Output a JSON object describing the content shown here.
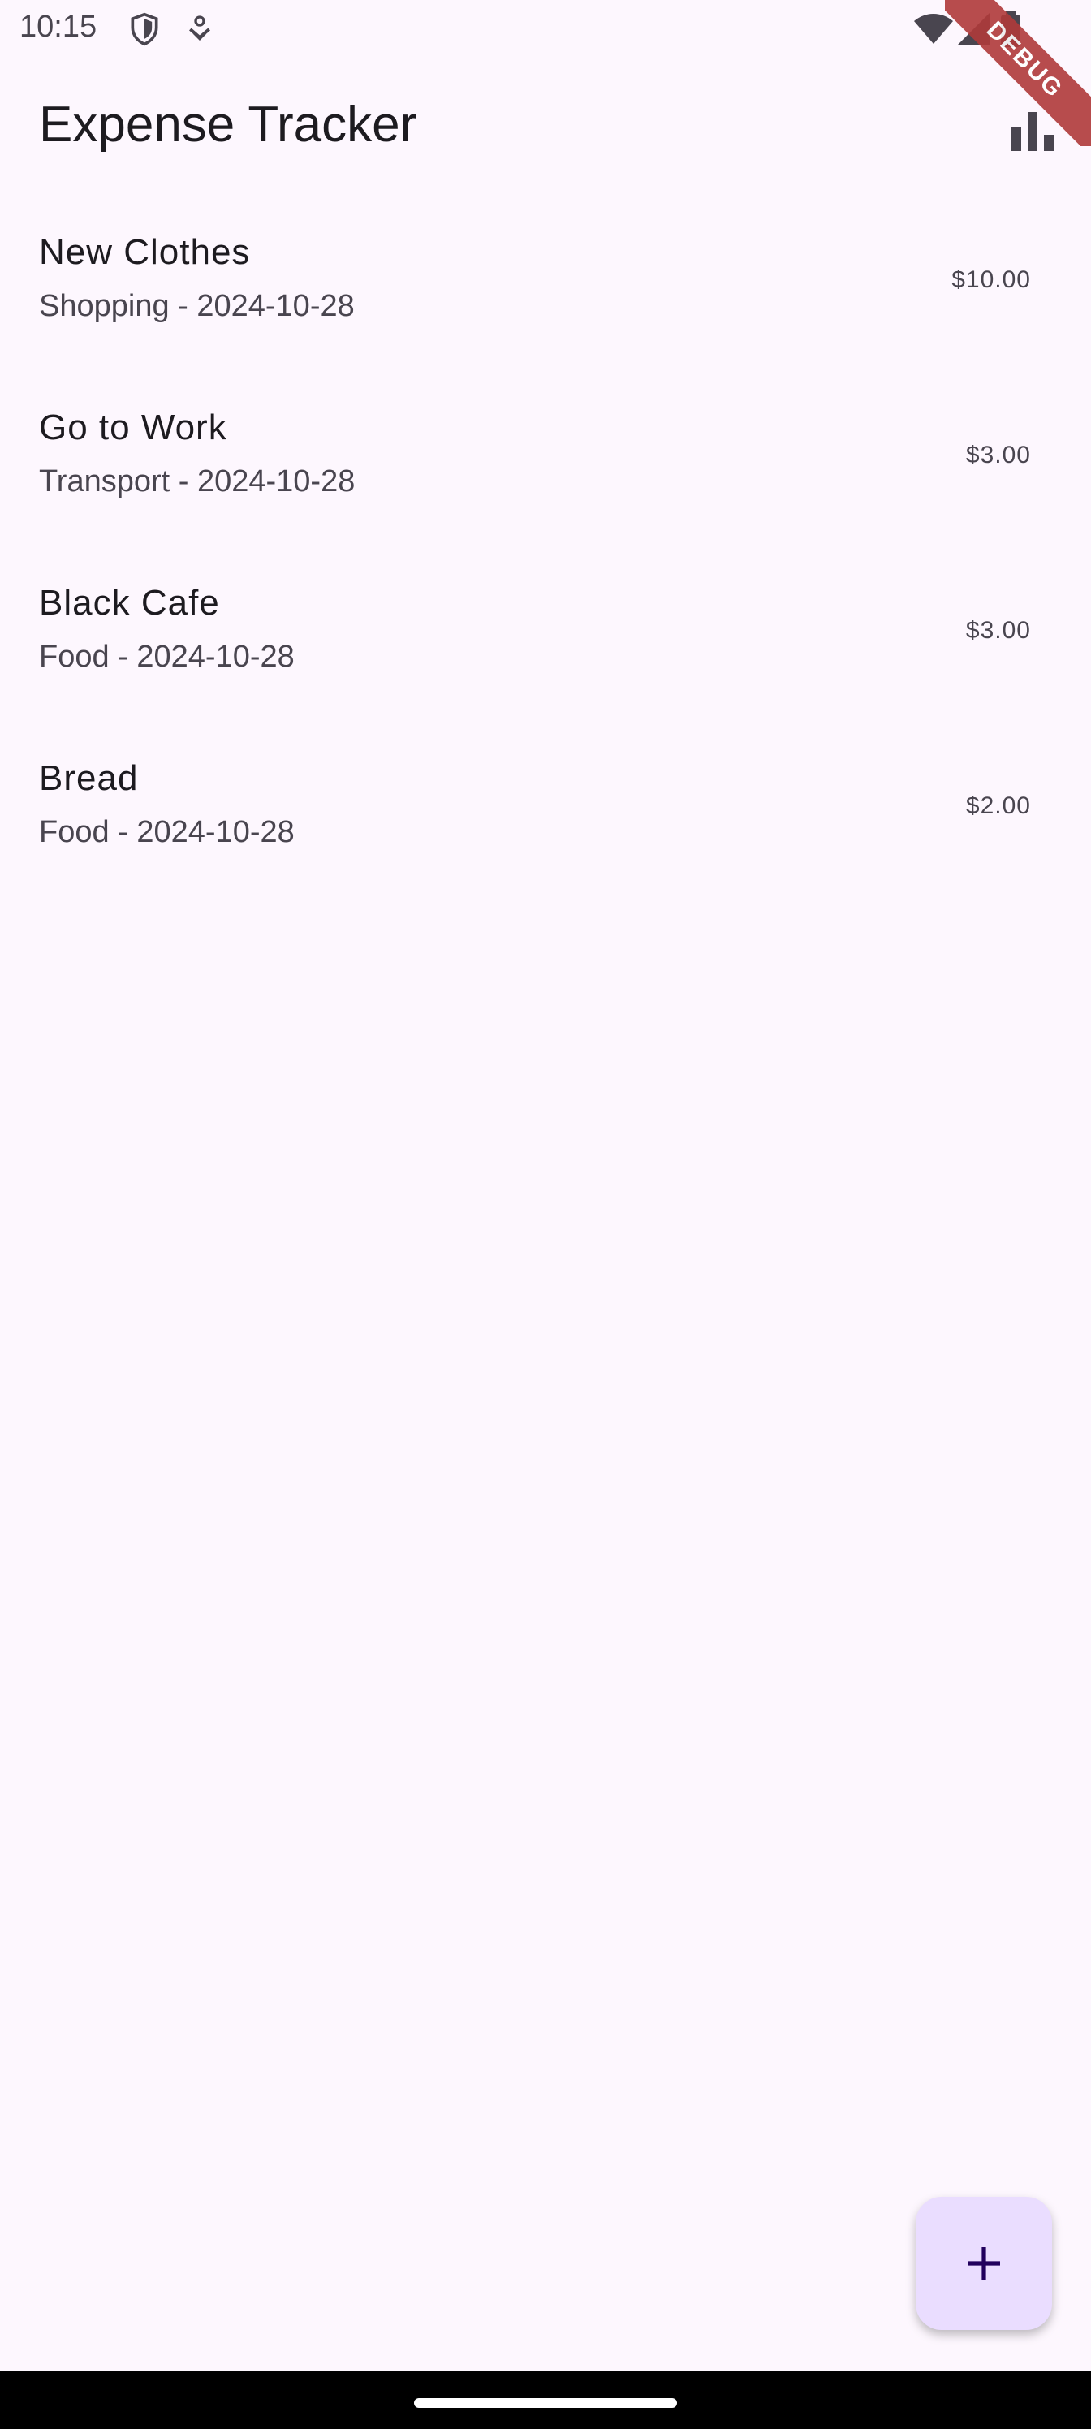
{
  "status_bar": {
    "time": "10:15",
    "debug_label": "DEBUG"
  },
  "app_bar": {
    "title": "Expense Tracker",
    "stats_icon": "bar-chart-icon"
  },
  "expenses": [
    {
      "title": "New Clothes",
      "subtitle": "Shopping - 2024-10-28",
      "amount": "$10.00"
    },
    {
      "title": "Go to Work",
      "subtitle": "Transport - 2024-10-28",
      "amount": "$3.00"
    },
    {
      "title": "Black Cafe",
      "subtitle": "Food - 2024-10-28",
      "amount": "$3.00"
    },
    {
      "title": "Bread",
      "subtitle": "Food - 2024-10-28",
      "amount": "$2.00"
    }
  ],
  "fab": {
    "icon": "plus-icon"
  },
  "colors": {
    "background": "#fdf7fe",
    "fab": "#eaddff",
    "text": "#1d1b20",
    "secondary_text": "#49454f"
  }
}
